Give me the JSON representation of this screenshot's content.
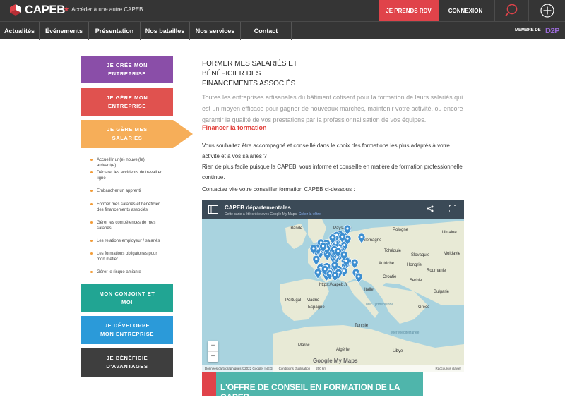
{
  "header": {
    "logo_text": "CAPEB",
    "other_capeb": "Accéder à une autre CAPEB",
    "rdv_label": "JE PRENDS RDV",
    "connexion_label": "CONNEXION"
  },
  "nav": {
    "items": [
      "Actualités",
      "Événements",
      "Présentation",
      "Nos batailles",
      "Nos services",
      "Contact"
    ],
    "membre": "MEMBRE DE",
    "d2p": "D2P"
  },
  "sidebar": {
    "buttons": [
      {
        "label": "JE CRÉE MON ENTREPRISE",
        "color": "#8a4ea8"
      },
      {
        "label": "JE GÈRE MON ENTREPRISE",
        "color": "#e0524f"
      },
      {
        "label": "JE GÈRE MES SALARIÉS",
        "color": "#f6ae59"
      },
      {
        "label": "MON CONJOINT ET MOI",
        "color": "#21a593"
      },
      {
        "label": "JE DÉVELOPPE MON ENTREPRISE",
        "color": "#2b9ad9"
      },
      {
        "label": "JE BÉNÉFICIE D'AVANTAGES",
        "color": "#3e3e3e"
      }
    ],
    "sub_items": [
      "Accueillir un(e) nouvel(le) arrivant(e)",
      "Déclarer les accidents de travail en ligne",
      "Embaucher un apprenti",
      "Former mes salariés et bénéficier des financements associés",
      "Gérer les compétences de mes salariés",
      "Les relations employeur / salariés",
      "Les formations obligatoires pour mon métier",
      "Gérer le risque amiante"
    ]
  },
  "main": {
    "title": "FORMER MES SALARIÉS ET BÉNÉFICIER DES FINANCEMENTS ASSOCIÉS",
    "intro": "Toutes les entreprises artisanales du bâtiment cotisent pour la formation de leurs salariés qui est un moyen efficace pour gagner de nouveaux marchés, maintenir votre activité, ou encore garantir la qualité de vos prestations par la professionnalisation de vos équipes.",
    "financer": "Financer la formation",
    "paragraph1": "Vous souhaitez être accompagné et conseillé dans le choix des formations les plus adaptés à votre activité et à vos salariés ?",
    "paragraph2": "Rien de plus facile puisque la CAPEB, vous informe et conseille en matière de formation professionnelle continue.",
    "contact_line": "Contactez vite votre conseiller formation CAPEB ci-dessous :"
  },
  "map": {
    "title": "CAPEB départementales",
    "subtitle": "Cette carte a été créée avec Google My Maps.",
    "subtitle_link": "Créez la vôtre.",
    "labels": {
      "irlande": "Irlande",
      "pays_bas": "Pays-Bas",
      "pologne": "Pologne",
      "allemagne": "Allemagne",
      "tchequie": "Tchéquie",
      "ukraine": "Ukraine",
      "slovaquie": "Slovaquie",
      "autriche": "Autriche",
      "hongrie": "Hongrie",
      "moldavie": "Moldavie",
      "roumanie": "Roumanie",
      "croatie": "Croatie",
      "serbie": "Serbie",
      "bulgarie": "Bulgarie",
      "italie": "Italie",
      "portugal": "Portugal",
      "madrid": "Madrid",
      "espagne": "Espagne",
      "mer_tyrrhenienne": "Mer Tyrrhénienne",
      "grece": "Grèce",
      "tunisie": "Tunisie",
      "maroc": "Maroc",
      "algerie": "Algérie",
      "libye": "Libye",
      "mer_mediterranee": "Mer Méditerranée",
      "url": "https://capeb.fr"
    },
    "google": "Google My Maps",
    "attribution": "Données cartographiques ©2022 Google, INEGI",
    "conditions": "Conditions d'utilisation",
    "scale": "200 km",
    "shortcuts": "Raccourcis clavier"
  },
  "banner": {
    "text": "L'OFFRE DE CONSEIL EN FORMATION DE LA CAPEB"
  },
  "colors": {
    "accent_red": "#e0434a",
    "pin_blue": "#3d8fd1",
    "map_sea": "#a9d3df",
    "map_land": "#e8ead6"
  }
}
